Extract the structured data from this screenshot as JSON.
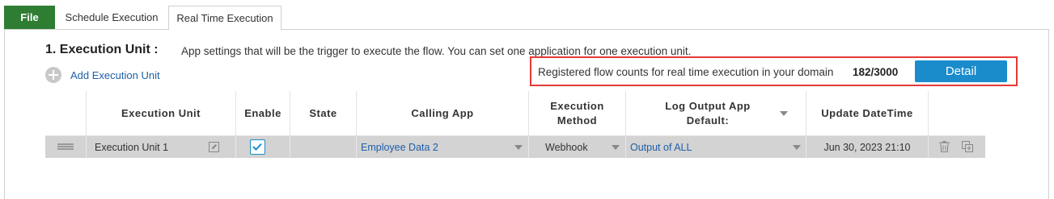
{
  "tabs": {
    "file": "File",
    "schedule": "Schedule Execution",
    "realtime": "Real Time Execution"
  },
  "section": {
    "title": "1. Execution Unit :",
    "description": "App settings that will be the trigger to execute the flow. You can set one application for one execution unit."
  },
  "add_unit_label": "Add Execution Unit",
  "registered": {
    "text": "Registered flow counts for real time execution in your domain",
    "count": "182/3000",
    "detail_label": "Detail"
  },
  "table": {
    "headers": {
      "unit": "Execution Unit",
      "enable": "Enable",
      "state": "State",
      "calling_app": "Calling App",
      "method": "Execution Method",
      "log_output": "Log Output App Default:",
      "update": "Update DateTime"
    },
    "rows": [
      {
        "unit": "Execution Unit 1",
        "enabled": true,
        "state": "",
        "calling_app": "Employee Data 2",
        "method": "Webhook",
        "log_output": "Output of ALL",
        "update": "Jun 30, 2023 21:10"
      }
    ]
  },
  "colors": {
    "file_tab": "#2e7d32",
    "accent": "#1a8ccc",
    "highlight_border": "#e53935",
    "link": "#1f5fa8",
    "row_bg": "#d3d3d3"
  }
}
